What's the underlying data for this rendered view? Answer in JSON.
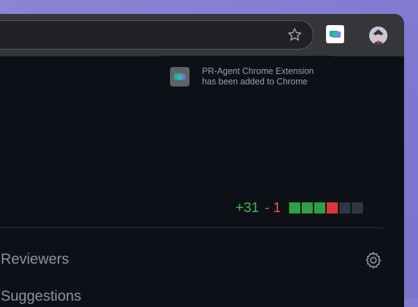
{
  "browser": {
    "bookmark_icon": "star-icon",
    "extension_icon": "pr-agent-extension-icon",
    "profile_icon": "avatar-icon"
  },
  "popup": {
    "line1": "PR-Agent Chrome Extension",
    "line2": "has been added to Chrome"
  },
  "pr": {
    "additions": "+31",
    "deletions": "- 1",
    "diff_blocks": [
      "add",
      "add",
      "add",
      "del",
      "neutral",
      "neutral"
    ],
    "reviewers_label": "Reviewers",
    "suggestions_label": "Suggestions"
  },
  "colors": {
    "add": "#3fb950",
    "del": "#f85149",
    "diff_add_block": "#2ea043",
    "diff_del_block": "#da3633",
    "diff_neutral_block": "#30363d"
  }
}
